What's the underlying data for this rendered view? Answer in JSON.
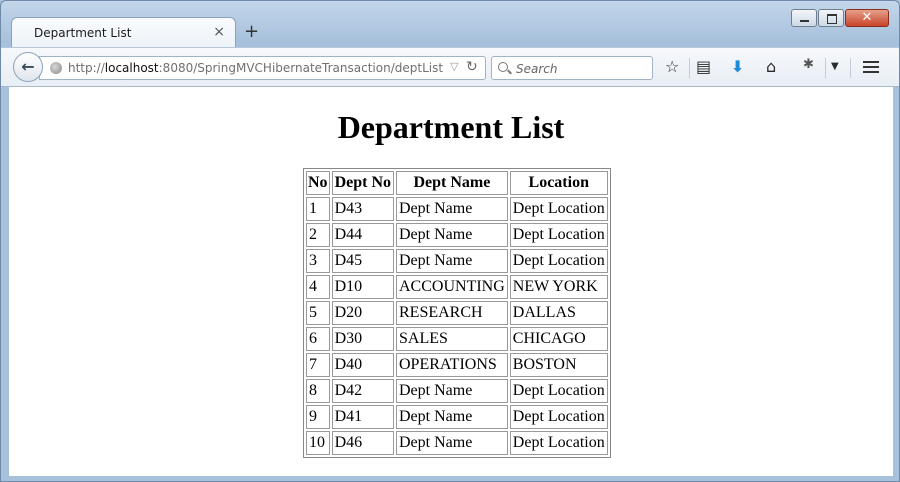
{
  "browser": {
    "tab_title": "Department List",
    "tab_close": "×",
    "new_tab": "+",
    "url_prefix": "http://",
    "url_host": "localhost",
    "url_rest": ":8080/SpringMVCHibernateTransaction/deptList",
    "search_placeholder": "Search",
    "icons": [
      "back-icon",
      "globe-icon",
      "url-dropdown-icon",
      "reload-icon",
      "search-icon",
      "star-icon",
      "reading-list-icon",
      "download-icon",
      "home-icon",
      "addon-icon",
      "menu-dropdown-icon",
      "hamburger-menu-icon"
    ],
    "accent_download": "#1f8bd7",
    "close_button_color": "#c8442a"
  },
  "page": {
    "title": "Department List",
    "table": {
      "headers": [
        "No",
        "Dept No",
        "Dept Name",
        "Location"
      ],
      "rows": [
        [
          "1",
          "D43",
          "Dept Name",
          "Dept Location"
        ],
        [
          "2",
          "D44",
          "Dept Name",
          "Dept Location"
        ],
        [
          "3",
          "D45",
          "Dept Name",
          "Dept Location"
        ],
        [
          "4",
          "D10",
          "ACCOUNTING",
          "NEW YORK"
        ],
        [
          "5",
          "D20",
          "RESEARCH",
          "DALLAS"
        ],
        [
          "6",
          "D30",
          "SALES",
          "CHICAGO"
        ],
        [
          "7",
          "D40",
          "OPERATIONS",
          "BOSTON"
        ],
        [
          "8",
          "D42",
          "Dept Name",
          "Dept Location"
        ],
        [
          "9",
          "D41",
          "Dept Name",
          "Dept Location"
        ],
        [
          "10",
          "D46",
          "Dept Name",
          "Dept Location"
        ]
      ]
    }
  }
}
